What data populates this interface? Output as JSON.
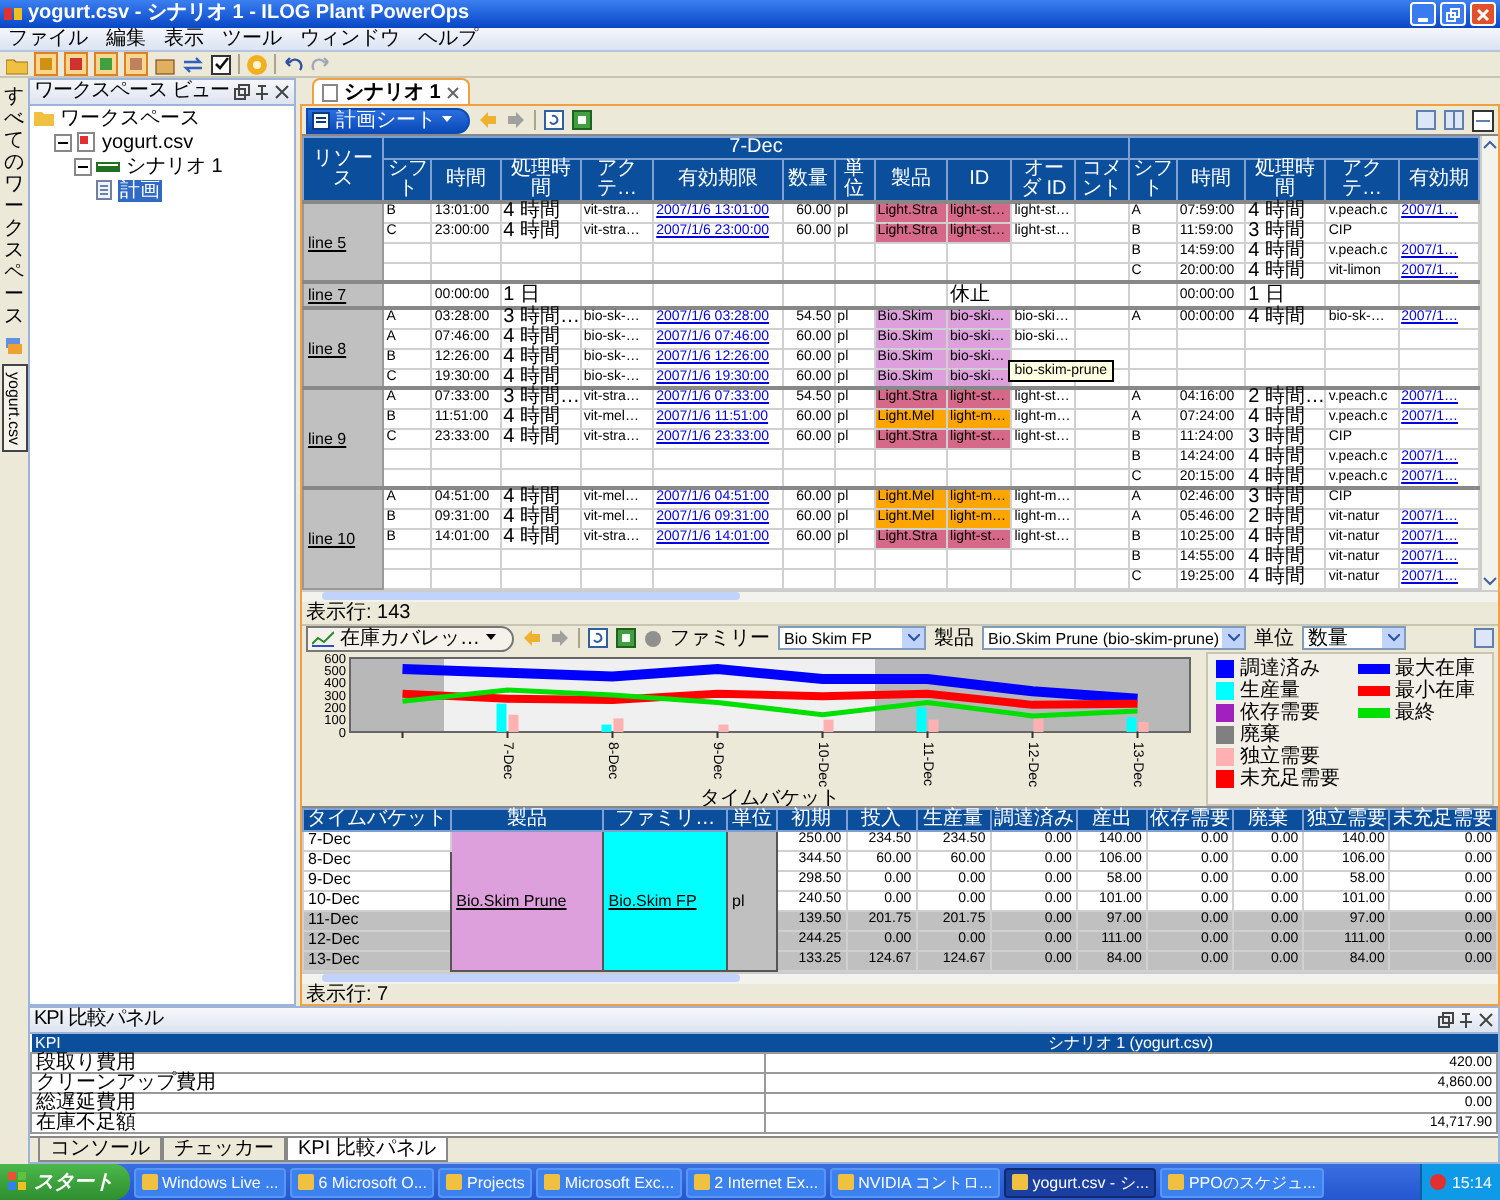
{
  "window": {
    "title": "yogurt.csv - シナリオ 1 - ILOG Plant PowerOps"
  },
  "menu": [
    "ファイル",
    "編集",
    "表示",
    "ツール",
    "ウィンドウ",
    "ヘルプ"
  ],
  "side_panel": {
    "title": "すべてのワークスペース",
    "tabs": [
      {
        "label": "yogurt.csv",
        "selected": true
      }
    ]
  },
  "workspace": {
    "title": "ワークスペース ビュー",
    "tree": [
      {
        "label": "ワークスペース",
        "kind": "workspace",
        "selected": false,
        "children": [
          {
            "label": "yogurt.csv",
            "kind": "file",
            "selected": false,
            "expanded": true,
            "children": [
              {
                "label": "シナリオ 1",
                "kind": "scenario",
                "selected": false,
                "expanded": true,
                "children": [
                  {
                    "label": "計画",
                    "kind": "plan",
                    "selected": true
                  }
                ]
              }
            ]
          }
        ]
      }
    ]
  },
  "editor_tabs": [
    {
      "label": "シナリオ 1",
      "selected": true
    }
  ],
  "plan": {
    "sheet": "計画シート",
    "resource_header": "リソース",
    "group_header": "7-Dec",
    "left_columns": [
      "シフト",
      "時間",
      "処理時間",
      "アクテ…",
      "有効期限",
      "数量",
      "単位",
      "製品",
      "ID",
      "オーダ ID",
      "コメント"
    ],
    "right_columns": [
      "シフト",
      "時間",
      "処理時間",
      "アクテ…",
      "有効期"
    ],
    "resources": [
      {
        "name": "line 5",
        "rows": [
          {
            "left": {
              "shift": "B",
              "time": "13:01:00",
              "duration": "4 時間",
              "activity": "vit-stra…",
              "expiry": "2007/1/6 13:01:00",
              "quantity": "60.00",
              "unit": "pl",
              "product": "Light.Stra",
              "id": "light-st…",
              "order_id": "light-st…",
              "color": "#d6688a"
            },
            "right": {
              "shift": "A",
              "time": "07:59:00",
              "duration": "4 時間",
              "activity": "v.peach.c",
              "expiry": "2007/1…"
            }
          },
          {
            "left": {
              "shift": "C",
              "time": "23:00:00",
              "duration": "4 時間",
              "activity": "vit-stra…",
              "expiry": "2007/1/6 23:00:00",
              "quantity": "60.00",
              "unit": "pl",
              "product": "Light.Stra",
              "id": "light-st…",
              "order_id": "light-st…",
              "color": "#d6688a"
            },
            "right": {
              "shift": "B",
              "time": "11:59:00",
              "duration": "3 時間",
              "activity": "CIP"
            }
          },
          {
            "right": {
              "shift": "B",
              "time": "14:59:00",
              "duration": "4 時間",
              "activity": "v.peach.c",
              "expiry": "2007/1…"
            }
          },
          {
            "right": {
              "shift": "C",
              "time": "20:00:00",
              "duration": "4 時間",
              "activity": "vit-limon",
              "expiry": "2007/1…"
            }
          }
        ]
      },
      {
        "name": "line 7",
        "rows": [
          {
            "left": {
              "time": "00:00:00",
              "duration": "1 日",
              "note": "休止"
            },
            "right": {
              "time": "00:00:00",
              "duration": "1 日"
            }
          }
        ]
      },
      {
        "name": "line 8",
        "rows": [
          {
            "left": {
              "shift": "A",
              "time": "03:28:00",
              "duration": "3 時間…",
              "activity": "bio-sk-…",
              "expiry": "2007/1/6 03:28:00",
              "quantity": "54.50",
              "unit": "pl",
              "product": "Bio.Skim",
              "id": "bio-ski…",
              "order_id": "bio-ski…",
              "color": "#dda0dd"
            },
            "right": {
              "shift": "A",
              "time": "00:00:00",
              "duration": "4 時間",
              "activity": "bio-sk-…",
              "expiry": "2007/1…"
            }
          },
          {
            "left": {
              "shift": "A",
              "time": "07:46:00",
              "duration": "4 時間",
              "activity": "bio-sk-…",
              "expiry": "2007/1/6 07:46:00",
              "quantity": "60.00",
              "unit": "pl",
              "product": "Bio.Skim",
              "id": "bio-ski…",
              "order_id": "bio-ski…",
              "color": "#dda0dd"
            }
          },
          {
            "left": {
              "shift": "B",
              "time": "12:26:00",
              "duration": "4 時間",
              "activity": "bio-sk-…",
              "expiry": "2007/1/6 12:26:00",
              "quantity": "60.00",
              "unit": "pl",
              "product": "Bio.Skim",
              "id": "bio-ski…",
              "tooltip": "bio-skim-prune",
              "color": "#dda0dd"
            }
          },
          {
            "left": {
              "shift": "C",
              "time": "19:30:00",
              "duration": "4 時間",
              "activity": "bio-sk-…",
              "expiry": "2007/1/6 19:30:00",
              "quantity": "60.00",
              "unit": "pl",
              "product": "Bio.Skim",
              "id": "bio-ski…",
              "color": "#dda0dd"
            }
          }
        ]
      },
      {
        "name": "line 9",
        "rows": [
          {
            "left": {
              "shift": "A",
              "time": "07:33:00",
              "duration": "3 時間…",
              "activity": "vit-stra…",
              "expiry": "2007/1/6 07:33:00",
              "quantity": "54.50",
              "unit": "pl",
              "product": "Light.Stra",
              "id": "light-st…",
              "order_id": "light-st…",
              "color": "#d6688a"
            },
            "right": {
              "shift": "A",
              "time": "04:16:00",
              "duration": "2 時間…",
              "activity": "v.peach.c",
              "expiry": "2007/1…"
            }
          },
          {
            "left": {
              "shift": "B",
              "time": "11:51:00",
              "duration": "4 時間",
              "activity": "vit-mel…",
              "expiry": "2007/1/6 11:51:00",
              "quantity": "60.00",
              "unit": "pl",
              "product": "Light.Mel",
              "id": "light-m…",
              "order_id": "light-m…",
              "color": "#ffa500"
            },
            "right": {
              "shift": "A",
              "time": "07:24:00",
              "duration": "4 時間",
              "activity": "v.peach.c",
              "expiry": "2007/1…"
            }
          },
          {
            "left": {
              "shift": "C",
              "time": "23:33:00",
              "duration": "4 時間",
              "activity": "vit-stra…",
              "expiry": "2007/1/6 23:33:00",
              "quantity": "60.00",
              "unit": "pl",
              "product": "Light.Stra",
              "id": "light-st…",
              "order_id": "light-st…",
              "color": "#d6688a"
            },
            "right": {
              "shift": "B",
              "time": "11:24:00",
              "duration": "3 時間",
              "activity": "CIP"
            }
          },
          {
            "right": {
              "shift": "B",
              "time": "14:24:00",
              "duration": "4 時間",
              "activity": "v.peach.c",
              "expiry": "2007/1…"
            }
          },
          {
            "right": {
              "shift": "C",
              "time": "20:15:00",
              "duration": "4 時間",
              "activity": "v.peach.c",
              "expiry": "2007/1…"
            }
          }
        ]
      },
      {
        "name": "line 10",
        "rows": [
          {
            "left": {
              "shift": "A",
              "time": "04:51:00",
              "duration": "4 時間",
              "activity": "vit-mel…",
              "expiry": "2007/1/6 04:51:00",
              "quantity": "60.00",
              "unit": "pl",
              "product": "Light.Mel",
              "id": "light-m…",
              "order_id": "light-m…",
              "color": "#ffa500"
            },
            "right": {
              "shift": "A",
              "time": "02:46:00",
              "duration": "3 時間",
              "activity": "CIP"
            }
          },
          {
            "left": {
              "shift": "B",
              "time": "09:31:00",
              "duration": "4 時間",
              "activity": "vit-mel…",
              "expiry": "2007/1/6 09:31:00",
              "quantity": "60.00",
              "unit": "pl",
              "product": "Light.Mel",
              "id": "light-m…",
              "order_id": "light-m…",
              "color": "#ffa500"
            },
            "right": {
              "shift": "A",
              "time": "05:46:00",
              "duration": "2 時間",
              "activity": "vit-natur",
              "expiry": "2007/1…"
            }
          },
          {
            "left": {
              "shift": "B",
              "time": "14:01:00",
              "duration": "4 時間",
              "activity": "vit-stra…",
              "expiry": "2007/1/6 14:01:00",
              "quantity": "60.00",
              "unit": "pl",
              "product": "Light.Stra",
              "id": "light-st…",
              "order_id": "light-st…",
              "color": "#d6688a"
            },
            "right": {
              "shift": "B",
              "time": "10:25:00",
              "duration": "4 時間",
              "activity": "vit-natur",
              "expiry": "2007/1…"
            }
          },
          {
            "right": {
              "shift": "B",
              "time": "14:55:00",
              "duration": "4 時間",
              "activity": "vit-natur",
              "expiry": "2007/1…"
            }
          },
          {
            "right": {
              "shift": "C",
              "time": "19:25:00",
              "duration": "4 時間",
              "activity": "vit-natur",
              "expiry": "2007/1…"
            }
          }
        ]
      }
    ],
    "status": "表示行: 143"
  },
  "coverage": {
    "view": "在庫カバレッ…",
    "family_label": "ファミリー",
    "family": "Bio Skim FP",
    "product_label": "製品",
    "product": "Bio.Skim Prune (bio-skim-prune)",
    "unit_label": "単位",
    "unit": "数量",
    "chart_data": {
      "type": "line",
      "xlabel": "タイムバケット",
      "categories": [
        null,
        "7-Dec",
        "8-Dec",
        "9-Dec",
        "10-Dec",
        "11-Dec",
        "12-Dec",
        "13-Dec"
      ],
      "ylim": [
        0,
        600
      ],
      "yticks": [
        0,
        100,
        200,
        300,
        400,
        500,
        600
      ],
      "series": [
        {
          "name": "調達済み",
          "type": "bar",
          "color": "#0000ff",
          "values": [
            null,
            0,
            0,
            0,
            0,
            0,
            0,
            0
          ]
        },
        {
          "name": "生産量",
          "type": "bar",
          "color": "#00ffff",
          "values": [
            null,
            230,
            60,
            0,
            0,
            200,
            0,
            120
          ]
        },
        {
          "name": "依存需要",
          "type": "bar",
          "color": "#a020c0",
          "values": [
            null,
            0,
            0,
            0,
            0,
            0,
            0,
            0
          ]
        },
        {
          "name": "廃棄",
          "type": "bar",
          "color": "#808080",
          "values": [
            null,
            0,
            0,
            0,
            0,
            0,
            0,
            0
          ]
        },
        {
          "name": "独立需要",
          "type": "bar",
          "color": "#ffb0b0",
          "values": [
            null,
            140,
            110,
            60,
            100,
            100,
            110,
            80
          ]
        },
        {
          "name": "未充足需要",
          "type": "bar",
          "color": "#ff0000",
          "values": [
            null,
            0,
            0,
            0,
            0,
            0,
            0,
            0
          ]
        },
        {
          "name": "最大在庫",
          "type": "line",
          "color": "#0000ff",
          "values": [
            510,
            480,
            450,
            510,
            430,
            430,
            330,
            270
          ]
        },
        {
          "name": "最小在庫",
          "type": "line",
          "color": "#ff0000",
          "values": [
            310,
            270,
            260,
            310,
            290,
            310,
            220,
            230
          ]
        },
        {
          "name": "最終",
          "type": "line",
          "color": "#00e000",
          "values": [
            250,
            340,
            300,
            240,
            140,
            240,
            130,
            170
          ]
        }
      ]
    },
    "table": {
      "columns": [
        "タイムバケット",
        "製品",
        "ファミリ…",
        "単位",
        "初期",
        "投入",
        "生産量",
        "調達済み",
        "産出",
        "依存需要",
        "廃棄",
        "独立需要",
        "未充足需要"
      ],
      "product": "Bio.Skim Prune",
      "family": "Bio.Skim FP",
      "unit": "pl",
      "rows": [
        {
          "bucket": "7-Dec",
          "shaded": false,
          "values": [
            "250.00",
            "234.50",
            "234.50",
            "0.00",
            "140.00",
            "0.00",
            "0.00",
            "140.00",
            "0.00"
          ]
        },
        {
          "bucket": "8-Dec",
          "shaded": false,
          "values": [
            "344.50",
            "60.00",
            "60.00",
            "0.00",
            "106.00",
            "0.00",
            "0.00",
            "106.00",
            "0.00"
          ]
        },
        {
          "bucket": "9-Dec",
          "shaded": false,
          "values": [
            "298.50",
            "0.00",
            "0.00",
            "0.00",
            "58.00",
            "0.00",
            "0.00",
            "58.00",
            "0.00"
          ]
        },
        {
          "bucket": "10-Dec",
          "shaded": false,
          "values": [
            "240.50",
            "0.00",
            "0.00",
            "0.00",
            "101.00",
            "0.00",
            "0.00",
            "101.00",
            "0.00"
          ]
        },
        {
          "bucket": "11-Dec",
          "shaded": true,
          "values": [
            "139.50",
            "201.75",
            "201.75",
            "0.00",
            "97.00",
            "0.00",
            "0.00",
            "97.00",
            "0.00"
          ]
        },
        {
          "bucket": "12-Dec",
          "shaded": true,
          "values": [
            "244.25",
            "0.00",
            "0.00",
            "0.00",
            "111.00",
            "0.00",
            "0.00",
            "111.00",
            "0.00"
          ]
        },
        {
          "bucket": "13-Dec",
          "shaded": true,
          "values": [
            "133.25",
            "124.67",
            "124.67",
            "0.00",
            "84.00",
            "0.00",
            "0.00",
            "84.00",
            "0.00"
          ]
        }
      ]
    },
    "status": "表示行: 7"
  },
  "kpi": {
    "title": "KPI 比較パネル",
    "columns": [
      "KPI",
      "シナリオ 1 (yogurt.csv)"
    ],
    "rows": [
      {
        "name": "段取り費用",
        "value": "420.00"
      },
      {
        "name": "クリーンアップ費用",
        "value": "4,860.00"
      },
      {
        "name": "総遅延費用",
        "value": "0.00"
      },
      {
        "name": "在庫不足額",
        "value": "14,717.90"
      }
    ],
    "tabs": [
      {
        "label": "コンソール",
        "selected": false
      },
      {
        "label": "チェッカー",
        "selected": false
      },
      {
        "label": "KPI 比較パネル",
        "selected": true
      }
    ]
  },
  "taskbar": {
    "start": "スタート",
    "items": [
      {
        "label": "Windows Live ...",
        "selected": false
      },
      {
        "label": "6 Microsoft O...",
        "selected": false
      },
      {
        "label": "Projects",
        "selected": false
      },
      {
        "label": "Microsoft Exc...",
        "selected": false
      },
      {
        "label": "2 Internet Ex...",
        "selected": false
      },
      {
        "label": "NVIDIA コントロ...",
        "selected": false
      },
      {
        "label": "yogurt.csv - シ...",
        "selected": true
      },
      {
        "label": "PPOのスケジュ...",
        "selected": false
      }
    ],
    "clock": "15:14"
  }
}
